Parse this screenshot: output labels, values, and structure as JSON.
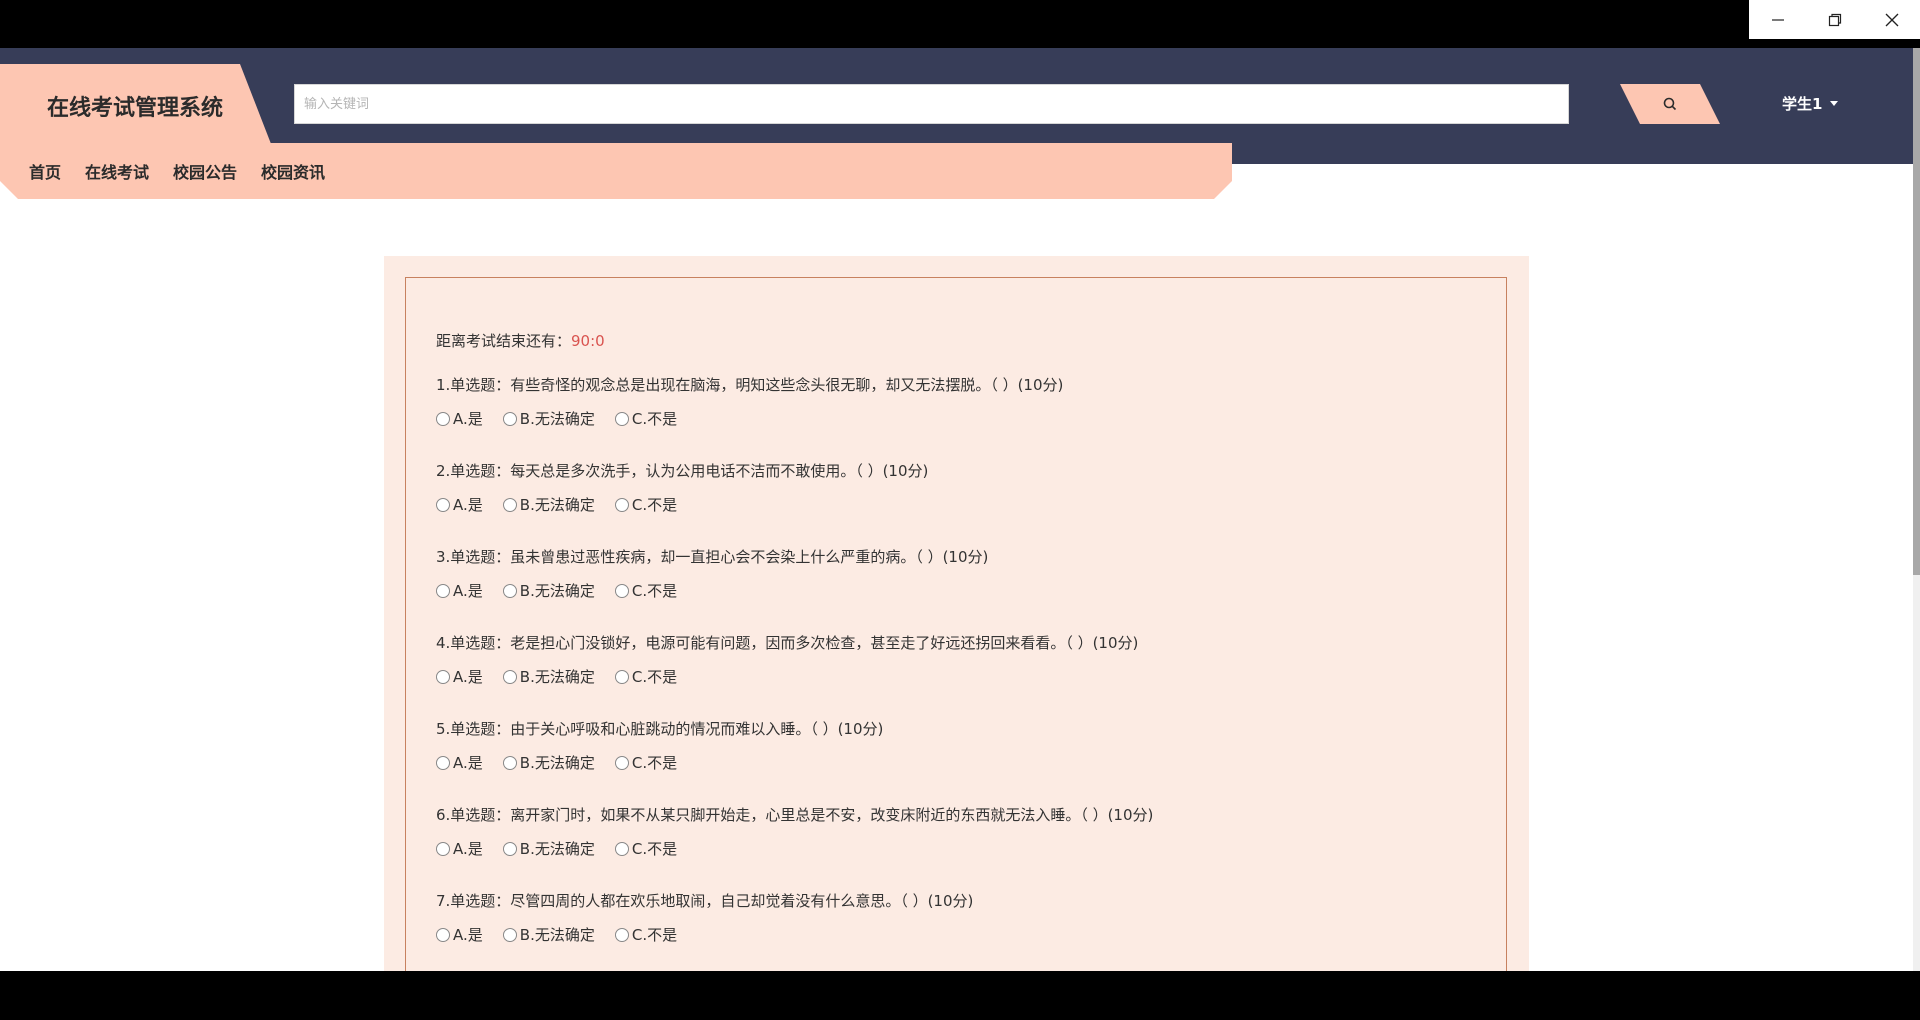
{
  "window": {
    "minimize_icon": "minimize-icon",
    "restore_icon": "restore-icon",
    "close_icon": "close-icon"
  },
  "header": {
    "brand_title": "在线考试管理系统",
    "search_placeholder": "输入关键词",
    "search_icon": "search-icon",
    "user_label": "学生1"
  },
  "nav": {
    "items": [
      "首页",
      "在线考试",
      "校园公告",
      "校园资讯"
    ]
  },
  "exam": {
    "countdown_label": "距离考试结束还有：",
    "countdown_value": "90:0",
    "options": [
      "A.是",
      "B.无法确定",
      "C.不是"
    ],
    "questions": [
      "1.单选题：有些奇怪的观念总是出现在脑海，明知这些念头很无聊，却又无法摆脱。（ ）(10分)",
      "2.单选题：每天总是多次洗手，认为公用电话不洁而不敢使用。（ ）(10分)",
      "3.单选题：虽未曾患过恶性疾病，却一直担心会不会染上什么严重的病。（ ）(10分)",
      "4.单选题：老是担心门没锁好，电源可能有问题，因而多次检查，甚至走了好远还拐回来看看。（ ）(10分)",
      "5.单选题：由于关心呼吸和心脏跳动的情况而难以入睡。（ ）(10分)",
      "6.单选题：离开家门时，如果不从某只脚开始走，心里总是不安，改变床附近的东西就无法入睡。（ ）(10分)",
      "7.单选题：尽管四周的人都在欢乐地取闹，自己却觉着没有什么意思。（ ）(10分)"
    ]
  }
}
